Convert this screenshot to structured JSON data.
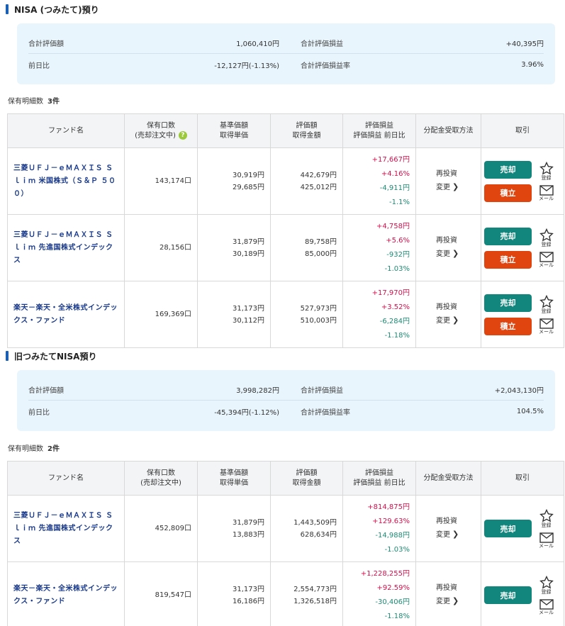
{
  "nisa": {
    "title": "NISA (つみたて)預り",
    "summary": {
      "total_value_label": "合計評価額",
      "total_value": "1,060,410円",
      "total_pl_label": "合計評価損益",
      "total_pl": "+40,395円",
      "day_change_label": "前日比",
      "day_change": "-12,127円(-1.13%)",
      "pl_rate_label": "合計評価損益率",
      "pl_rate": "3.96%"
    },
    "count_label": "保有明細数",
    "count": "3件",
    "headers": {
      "fund": "ファンド名",
      "units_1": "保有口数",
      "units_2": "(売却注文中)",
      "price_1": "基準価額",
      "price_2": "取得単価",
      "value_1": "評価額",
      "value_2": "取得金額",
      "pl_1": "評価損益",
      "pl_2": "評価損益 前日比",
      "dist": "分配金受取方法",
      "trade": "取引"
    },
    "rows": [
      {
        "fund": "三菱ＵＦＪ－ｅＭＡＸＩＳ Ｓｌｉｍ 米国株式（Ｓ＆Ｐ ５００）",
        "units": "143,174口",
        "price": "30,919円",
        "cost_price": "29,685円",
        "value": "442,679円",
        "cost": "425,012円",
        "pl": "+17,667円",
        "pl_rate": "+4.16%",
        "day": "-4,911円",
        "day_rate": "-1.1%",
        "dist": "再投資",
        "change": "変更",
        "sell": "売却",
        "buy": "積立",
        "fav": "登録",
        "mail": "メール"
      },
      {
        "fund": "三菱ＵＦＪ－ｅＭＡＸＩＳ Ｓｌｉｍ 先進国株式インデックス",
        "units": "28,156口",
        "price": "31,879円",
        "cost_price": "30,189円",
        "value": "89,758円",
        "cost": "85,000円",
        "pl": "+4,758円",
        "pl_rate": "+5.6%",
        "day": "-932円",
        "day_rate": "-1.03%",
        "dist": "再投資",
        "change": "変更",
        "sell": "売却",
        "buy": "積立",
        "fav": "登録",
        "mail": "メール"
      },
      {
        "fund": "楽天－楽天・全米株式インデックス・ファンド",
        "units": "169,369口",
        "price": "31,173円",
        "cost_price": "30,112円",
        "value": "527,973円",
        "cost": "510,003円",
        "pl": "+17,970円",
        "pl_rate": "+3.52%",
        "day": "-6,284円",
        "day_rate": "-1.18%",
        "dist": "再投資",
        "change": "変更",
        "sell": "売却",
        "buy": "積立",
        "fav": "登録",
        "mail": "メール"
      }
    ]
  },
  "old": {
    "title": "旧つみたてNISA預り",
    "summary": {
      "total_value_label": "合計評価額",
      "total_value": "3,998,282円",
      "total_pl_label": "合計評価損益",
      "total_pl": "+2,043,130円",
      "day_change_label": "前日比",
      "day_change": "-45,394円(-1.12%)",
      "pl_rate_label": "合計評価損益率",
      "pl_rate": "104.5%"
    },
    "count_label": "保有明細数",
    "count": "2件",
    "headers": {
      "fund": "ファンド名",
      "units_1": "保有口数",
      "units_2": "(売却注文中)",
      "price_1": "基準価額",
      "price_2": "取得単価",
      "value_1": "評価額",
      "value_2": "取得金額",
      "pl_1": "評価損益",
      "pl_2": "評価損益 前日比",
      "dist": "分配金受取方法",
      "trade": "取引"
    },
    "rows": [
      {
        "fund": "三菱ＵＦＪ－ｅＭＡＸＩＳ Ｓｌｉｍ 先進国株式インデックス",
        "units": "452,809口",
        "price": "31,879円",
        "cost_price": "13,883円",
        "value": "1,443,509円",
        "cost": "628,634円",
        "pl": "+814,875円",
        "pl_rate": "+129.63%",
        "day": "-14,988円",
        "day_rate": "-1.03%",
        "dist": "再投資",
        "change": "変更",
        "sell": "売却",
        "fav": "登録",
        "mail": "メール"
      },
      {
        "fund": "楽天－楽天・全米株式インデックス・ファンド",
        "units": "819,547口",
        "price": "31,173円",
        "cost_price": "16,186円",
        "value": "2,554,773円",
        "cost": "1,326,518円",
        "pl": "+1,228,255円",
        "pl_rate": "+92.59%",
        "day": "-30,406円",
        "day_rate": "-1.18%",
        "dist": "再投資",
        "change": "変更",
        "sell": "売却",
        "fav": "登録",
        "mail": "メール"
      }
    ]
  },
  "colors": {
    "positive": "#d0104c",
    "negative": "#1e8a73",
    "sell": "#12867c",
    "buy": "#e0440f",
    "accent": "#1b5fb5"
  },
  "icons": {
    "help": "help-icon",
    "star": "star-icon",
    "mail": "mail-icon",
    "chevron": "chevron-right-icon"
  }
}
